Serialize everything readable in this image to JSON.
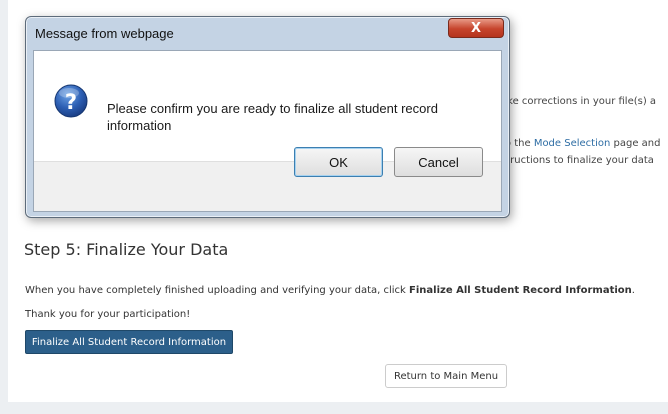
{
  "background": {
    "line1": "ake corrections in your file(s) a",
    "line2_prefix": "to the ",
    "line2_link": "Mode Selection",
    "line2_suffix": " page and",
    "line3": "structions to finalize your data",
    "step_heading": "Step 5: Finalize Your Data",
    "finalize_text_prefix": "When you have completely finished uploading and verifying your data, click ",
    "finalize_text_bold": "Finalize All Student Record Information",
    "finalize_text_suffix": ".",
    "thanks_text": "Thank you for your participation!",
    "finalize_button_label": "Finalize All Student Record Information",
    "return_button_label": "Return to Main Menu"
  },
  "dialog": {
    "title": "Message from webpage",
    "close_label": "X",
    "message": "Please confirm you are ready to finalize all student record information",
    "icon": "question-icon",
    "ok_label": "OK",
    "cancel_label": "Cancel"
  },
  "colors": {
    "primary_button": "#2c5f8a",
    "link": "#2e6da4",
    "close_button": "#c6442c",
    "dialog_frame": "#c4d3e4"
  }
}
